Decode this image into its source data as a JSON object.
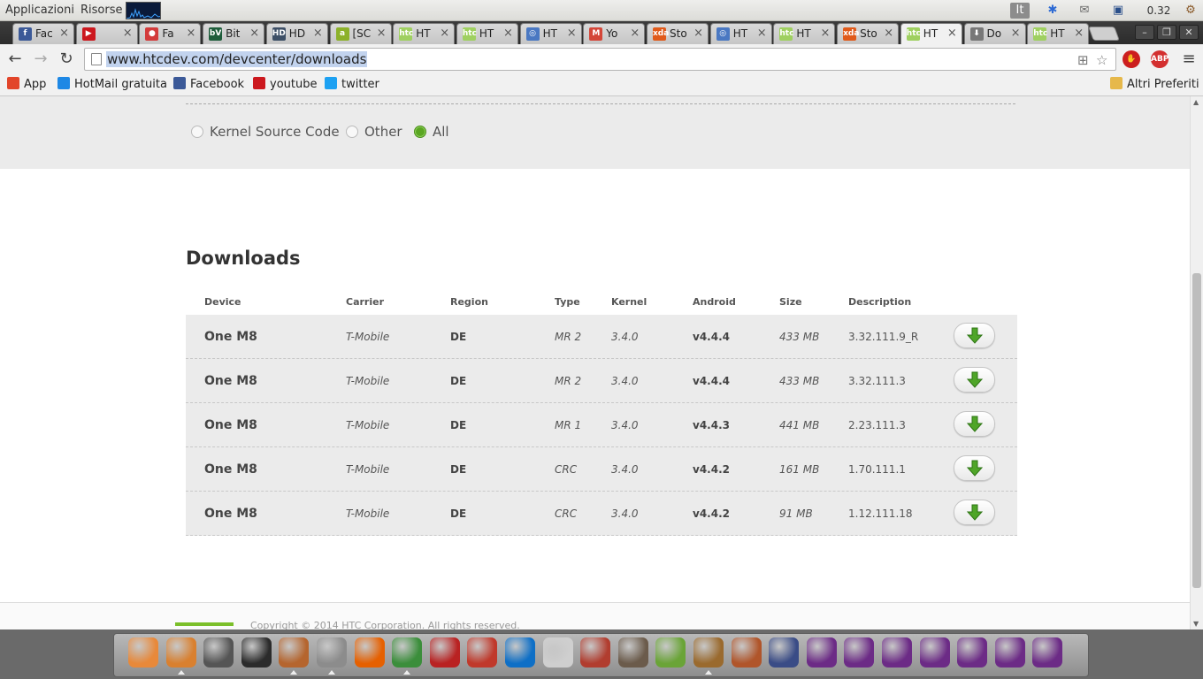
{
  "system_panel": {
    "menus": [
      "Applicazioni",
      "Risorse"
    ],
    "keyboard_layout": "It",
    "clock": "0.32"
  },
  "tabs": [
    {
      "label": "Fac",
      "icon": "facebook-favicon",
      "color": "#3b5998",
      "glyph": "f"
    },
    {
      "label": "",
      "icon": "youtube-favicon",
      "color": "#cc181e",
      "glyph": "▶"
    },
    {
      "label": "Fa",
      "icon": "pokeball-favicon",
      "color": "#d33b3b",
      "glyph": "●"
    },
    {
      "label": "Bit",
      "icon": "bitvise-favicon",
      "color": "#1e5d3b",
      "glyph": "bV"
    },
    {
      "label": "HD",
      "icon": "hd-favicon",
      "color": "#3d4f66",
      "glyph": "HD"
    },
    {
      "label": "[SC",
      "icon": "android-favicon",
      "color": "#8cb12a",
      "glyph": "a"
    },
    {
      "label": "HT",
      "icon": "htc-favicon",
      "color": "#9fd060",
      "glyph": "htc"
    },
    {
      "label": "HT",
      "icon": "htc-favicon",
      "color": "#9fd060",
      "glyph": "htc"
    },
    {
      "label": "HT",
      "icon": "globe-favicon",
      "color": "#4a78c2",
      "glyph": "◎"
    },
    {
      "label": "Yo",
      "icon": "gmail-favicon",
      "color": "#d44638",
      "glyph": "M"
    },
    {
      "label": "Sto",
      "icon": "xda-favicon",
      "color": "#e05a1a",
      "glyph": "xda"
    },
    {
      "label": "HT",
      "icon": "globe-favicon",
      "color": "#4a78c2",
      "glyph": "◎"
    },
    {
      "label": "HT",
      "icon": "htc-favicon",
      "color": "#9fd060",
      "glyph": "htc"
    },
    {
      "label": "Sto",
      "icon": "xda-favicon",
      "color": "#e05a1a",
      "glyph": "xda"
    },
    {
      "label": "HT",
      "icon": "htc-favicon",
      "color": "#9fd060",
      "glyph": "htc",
      "active": true
    },
    {
      "label": "Do",
      "icon": "download-favicon",
      "color": "#777777",
      "glyph": "⬇"
    },
    {
      "label": "HT",
      "icon": "htc-favicon",
      "color": "#9fd060",
      "glyph": "htc"
    }
  ],
  "toolbar": {
    "url": "www.htcdev.com/devcenter/downloads"
  },
  "bookmarks": [
    {
      "label": "App",
      "icon": "apps-grid-icon",
      "color": "#e2452a"
    },
    {
      "label": "HotMail gratuita",
      "icon": "windows-icon",
      "color": "#1e88e5"
    },
    {
      "label": "Facebook",
      "icon": "facebook-icon",
      "color": "#3b5998"
    },
    {
      "label": "youtube",
      "icon": "youtube-icon",
      "color": "#cc181e"
    },
    {
      "label": "twitter",
      "icon": "twitter-icon",
      "color": "#1da1f2"
    }
  ],
  "other_bookmarks": "Altri Preferiti",
  "filters": {
    "options": [
      {
        "label": "Kernel Source Code",
        "checked": false
      },
      {
        "label": "Other",
        "checked": false
      },
      {
        "label": "All",
        "checked": true
      }
    ]
  },
  "downloads": {
    "title": "Downloads",
    "columns": [
      "Device",
      "Carrier",
      "Region",
      "Type",
      "Kernel",
      "Android",
      "Size",
      "Description"
    ],
    "rows": [
      {
        "device": "One M8",
        "carrier": "T-Mobile",
        "region": "DE",
        "type": "MR 2",
        "kernel": "3.4.0",
        "android": "v4.4.4",
        "size": "433 MB",
        "description": "3.32.111.9_R"
      },
      {
        "device": "One M8",
        "carrier": "T-Mobile",
        "region": "DE",
        "type": "MR 2",
        "kernel": "3.4.0",
        "android": "v4.4.4",
        "size": "433 MB",
        "description": "3.32.111.3"
      },
      {
        "device": "One M8",
        "carrier": "T-Mobile",
        "region": "DE",
        "type": "MR 1",
        "kernel": "3.4.0",
        "android": "v4.4.3",
        "size": "441 MB",
        "description": "2.23.111.3"
      },
      {
        "device": "One M8",
        "carrier": "T-Mobile",
        "region": "DE",
        "type": "CRC",
        "kernel": "3.4.0",
        "android": "v4.4.2",
        "size": "161 MB",
        "description": "1.70.111.1"
      },
      {
        "device": "One M8",
        "carrier": "T-Mobile",
        "region": "DE",
        "type": "CRC",
        "kernel": "3.4.0",
        "android": "v4.4.2",
        "size": "91 MB",
        "description": "1.12.111.18"
      }
    ]
  },
  "footer": {
    "copyright": "Copyright © 2014 HTC Corporation. All rights reserved."
  },
  "dock": [
    {
      "icon": "ubuntu-software-icon",
      "color": "#e8893a"
    },
    {
      "icon": "rocket-launcher-icon",
      "color": "#d9802f"
    },
    {
      "icon": "system-settings-icon",
      "color": "#555555"
    },
    {
      "icon": "terminal-icon",
      "color": "#2b2b2b"
    },
    {
      "icon": "transmission-icon",
      "color": "#b5652e"
    },
    {
      "icon": "gdebi-package-icon",
      "color": "#8c8c8c"
    },
    {
      "icon": "firefox-icon",
      "color": "#e66000"
    },
    {
      "icon": "chrome-icon",
      "color": "#3b8e3b"
    },
    {
      "icon": "filezilla-icon",
      "color": "#b92222"
    },
    {
      "icon": "xchat-icon",
      "color": "#c0392b"
    },
    {
      "icon": "teamviewer-icon",
      "color": "#0e6fc6"
    },
    {
      "icon": "disc-burner-icon",
      "color": "#cfcfcf"
    },
    {
      "icon": "wine-icon",
      "color": "#b13d2f"
    },
    {
      "icon": "gimp-icon",
      "color": "#6b5b4b"
    },
    {
      "icon": "maze-game-icon",
      "color": "#6aa437"
    },
    {
      "icon": "owl-icon",
      "color": "#9a6a2e"
    },
    {
      "icon": "house-icon",
      "color": "#b0552a"
    },
    {
      "icon": "screenshot-icon",
      "color": "#3a4c86"
    },
    {
      "icon": "purple-folder-icon",
      "color": "#6c2b86"
    },
    {
      "icon": "purple-folder-music-icon",
      "color": "#6c2b86"
    },
    {
      "icon": "purple-folder-images-icon",
      "color": "#6c2b86"
    },
    {
      "icon": "purple-folder-video-icon",
      "color": "#6c2b86"
    },
    {
      "icon": "purple-folder-settings-icon",
      "color": "#6c2b86"
    },
    {
      "icon": "purple-folder-users-icon",
      "color": "#6c2b86"
    },
    {
      "icon": "purple-folder-apps-icon",
      "color": "#6c2b86"
    }
  ]
}
